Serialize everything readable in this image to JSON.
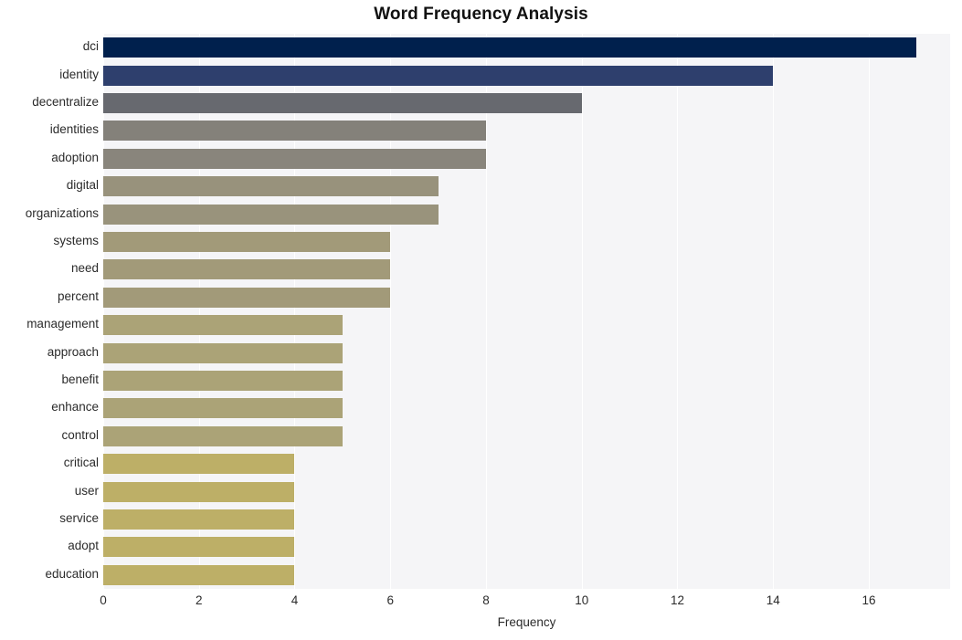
{
  "chart_data": {
    "type": "bar",
    "orientation": "horizontal",
    "title": "Word Frequency Analysis",
    "xlabel": "Frequency",
    "ylabel": "",
    "categories": [
      "dci",
      "identity",
      "decentralize",
      "identities",
      "adoption",
      "digital",
      "organizations",
      "systems",
      "need",
      "percent",
      "management",
      "approach",
      "benefit",
      "enhance",
      "control",
      "critical",
      "user",
      "service",
      "adopt",
      "education"
    ],
    "values": [
      17,
      14,
      10,
      8,
      8,
      7,
      7,
      6,
      6,
      6,
      5,
      5,
      5,
      5,
      5,
      4,
      4,
      4,
      4,
      4
    ],
    "bar_colors": [
      "#00204d",
      "#2e3f6d",
      "#67696f",
      "#84817a",
      "#89857c",
      "#98927c",
      "#99937c",
      "#a29a79",
      "#a29a79",
      "#a29a79",
      "#aba377",
      "#aba377",
      "#aba377",
      "#aba377",
      "#aba377",
      "#bdaf67",
      "#bdaf67",
      "#bdaf67",
      "#bdaf67",
      "#bdaf67"
    ],
    "xlim": [
      0,
      17.7
    ],
    "xticks": [
      0,
      2,
      4,
      6,
      8,
      10,
      12,
      14,
      16
    ],
    "xtick_labels": [
      "0",
      "2",
      "4",
      "6",
      "8",
      "10",
      "12",
      "14",
      "16"
    ],
    "grid": true,
    "grid_color": "#ffffff",
    "plot_background": "#f5f5f7",
    "figure_background": "#ffffff",
    "legend": null
  }
}
